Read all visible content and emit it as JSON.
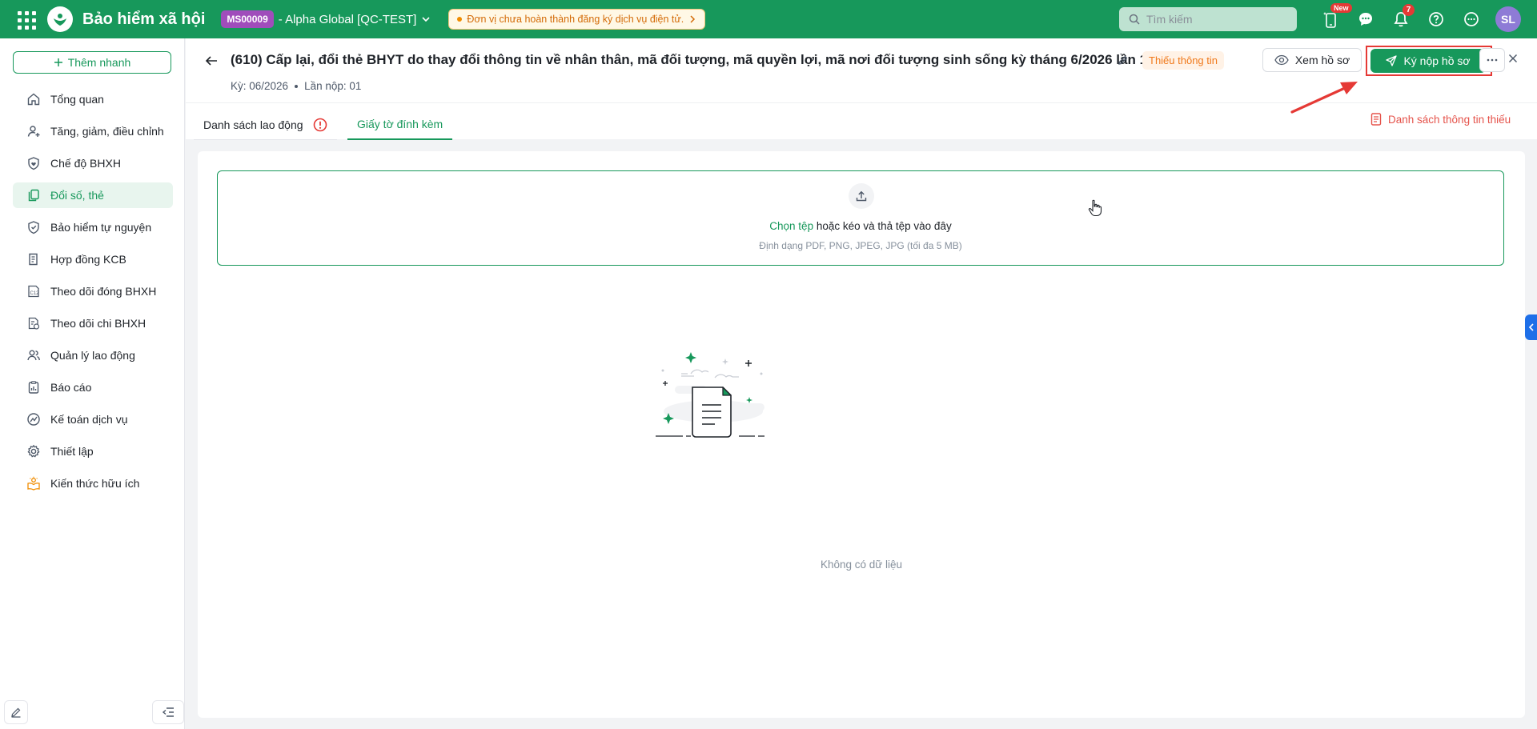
{
  "app": {
    "title": "Bảo hiểm xã hội",
    "org_code": "MS00009",
    "org_name": "- Alpha Global [QC-TEST]",
    "warning": "Đơn vị chưa hoàn thành đăng ký dịch vụ điện tử.",
    "search_placeholder": "Tìm kiếm",
    "new_badge": "New",
    "notification_count": "7",
    "avatar_initials": "SL",
    "brand_color": "#17985b"
  },
  "sidebar": {
    "quick_add": "Thêm nhanh",
    "items": [
      {
        "label": "Tổng quan",
        "icon": "home-icon"
      },
      {
        "label": "Tăng, giảm, điều chỉnh",
        "icon": "user-plus-icon"
      },
      {
        "label": "Chế độ BHXH",
        "icon": "shield-heart-icon"
      },
      {
        "label": "Đổi số, thẻ",
        "icon": "copy-card-icon"
      },
      {
        "label": "Bảo hiểm tự nguyện",
        "icon": "shield-icon"
      },
      {
        "label": "Hợp đồng KCB",
        "icon": "contract-icon"
      },
      {
        "label": "Theo dõi đóng BHXH",
        "icon": "c12-report-icon"
      },
      {
        "label": "Theo dõi chi BHXH",
        "icon": "document-money-icon"
      },
      {
        "label": "Quản lý lao động",
        "icon": "users-icon"
      },
      {
        "label": "Báo cáo",
        "icon": "clipboard-chart-icon"
      },
      {
        "label": "Kế toán dịch vụ",
        "icon": "accounting-icon"
      },
      {
        "label": "Thiết lập",
        "icon": "gear-icon"
      },
      {
        "label": "Kiến thức hữu ích",
        "icon": "lightbulb-book-icon"
      }
    ],
    "active_index": 3
  },
  "header": {
    "title": "(610) Cấp lại, đổi thẻ BHYT do thay đổi thông tin về nhân thân, mã đối tượng, mã quyền lợi, mã nơi đối tượng sinh sống kỳ tháng 6/2026 lần 1",
    "status": "Thiếu thông tin",
    "period": "Kỳ: 06/2026",
    "submission": "Lần nộp: 01",
    "view_button": "Xem hồ sơ",
    "sign_button": "Ký nộp hồ sơ"
  },
  "tabs": {
    "labor_list": "Danh sách lao động",
    "attachments": "Giấy tờ đính kèm",
    "missing_info_link": "Danh sách thông tin thiếu"
  },
  "upload": {
    "choose": "Chọn tệp",
    "drag_text": " hoặc kéo và thả tệp vào đây",
    "hint": "Định dạng PDF, PNG, JPEG, JPG (tối đa 5 MB)"
  },
  "empty": {
    "text": "Không có dữ liệu"
  }
}
